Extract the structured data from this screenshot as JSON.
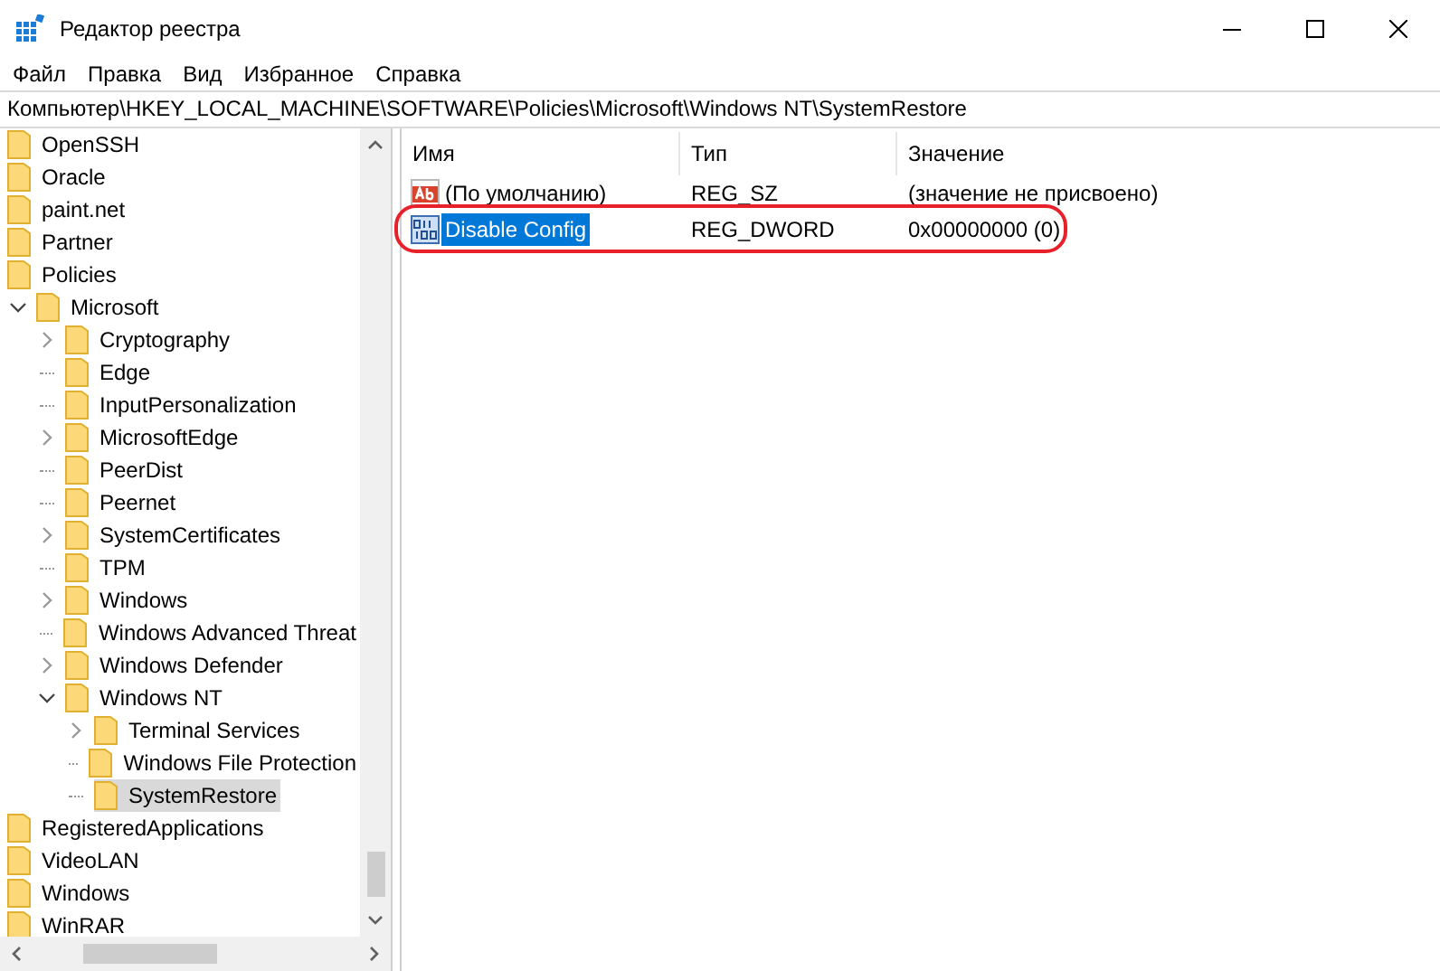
{
  "window": {
    "title": "Редактор реестра"
  },
  "menu": [
    "Файл",
    "Правка",
    "Вид",
    "Избранное",
    "Справка"
  ],
  "address": "Компьютер\\HKEY_LOCAL_MACHINE\\SOFTWARE\\Policies\\Microsoft\\Windows NT\\SystemRestore",
  "tree": [
    {
      "label": "OpenSSH",
      "selected": false
    },
    {
      "label": "Oracle",
      "selected": false
    },
    {
      "label": "paint.net",
      "selected": false
    },
    {
      "label": "Partner",
      "selected": false
    },
    {
      "label": "Policies",
      "selected": false,
      "children": [
        {
          "label": "Microsoft",
          "selected": false,
          "expanded": true,
          "children": [
            {
              "label": "Cryptography",
              "selected": false,
              "expanded": false
            },
            {
              "label": "Edge",
              "selected": false
            },
            {
              "label": "InputPersonalization",
              "selected": false
            },
            {
              "label": "MicrosoftEdge",
              "selected": false,
              "expanded": false
            },
            {
              "label": "PeerDist",
              "selected": false
            },
            {
              "label": "Peernet",
              "selected": false
            },
            {
              "label": "SystemCertificates",
              "selected": false,
              "expanded": false
            },
            {
              "label": "TPM",
              "selected": false
            },
            {
              "label": "Windows",
              "selected": false,
              "expanded": false
            },
            {
              "label": "Windows Advanced Threat",
              "selected": false
            },
            {
              "label": "Windows Defender",
              "selected": false,
              "expanded": false
            },
            {
              "label": "Windows NT",
              "selected": false,
              "expanded": true,
              "children": [
                {
                  "label": "Terminal Services",
                  "selected": false,
                  "expanded": false
                },
                {
                  "label": "Windows File Protection",
                  "selected": false
                },
                {
                  "label": "SystemRestore",
                  "selected": true
                }
              ]
            }
          ]
        }
      ]
    },
    {
      "label": "RegisteredApplications",
      "selected": false
    },
    {
      "label": "VideoLAN",
      "selected": false
    },
    {
      "label": "Windows",
      "selected": false
    },
    {
      "label": "WinRAR",
      "selected": false
    }
  ],
  "columns": [
    "Имя",
    "Тип",
    "Значение"
  ],
  "values": [
    {
      "kind": "string",
      "name": "(По умолчанию)",
      "type": "REG_SZ",
      "data": "(значение не присвоено)",
      "selected": false,
      "circled": false
    },
    {
      "kind": "binary",
      "name": "Disable Config",
      "type": "REG_DWORD",
      "data": "0x00000000 (0)",
      "selected": true,
      "circled": true
    }
  ]
}
